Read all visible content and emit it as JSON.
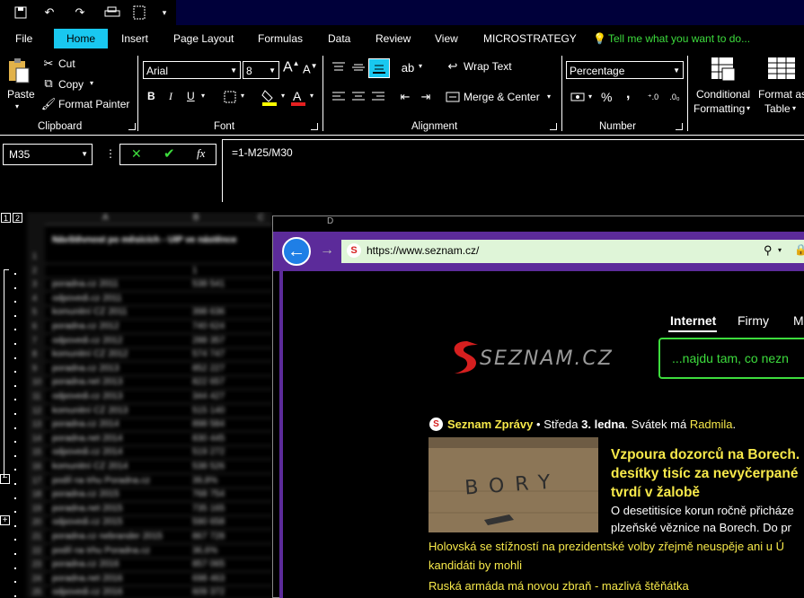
{
  "qat": {
    "icons": [
      "save-icon",
      "undo-icon",
      "redo-icon",
      "car-icon",
      "calculator-icon",
      "customize-icon"
    ]
  },
  "tabs": [
    "File",
    "Home",
    "Insert",
    "Page Layout",
    "Formulas",
    "Data",
    "Review",
    "View",
    "MICROSTRATEGY"
  ],
  "tell_me": "Tell me what you want to do...",
  "ribbon": {
    "clipboard": {
      "paste": "Paste",
      "cut": "Cut",
      "copy": "Copy",
      "format_painter": "Format Painter",
      "label": "Clipboard"
    },
    "font": {
      "name": "Arial",
      "size": "8",
      "bold": "B",
      "italic": "I",
      "underline": "U",
      "label": "Font"
    },
    "alignment": {
      "wrap_text": "Wrap Text",
      "merge_center": "Merge & Center",
      "label": "Alignment"
    },
    "number": {
      "format": "Percentage",
      "percent": "%",
      "comma": ",",
      "label": "Number"
    },
    "styles": {
      "conditional_1": "Conditional",
      "conditional_2": "Formatting",
      "format_as_1": "Format as",
      "format_as_2": "Table"
    }
  },
  "formula_bar": {
    "name_box": "M35",
    "formula": "=1-M25/M30"
  },
  "sheet": {
    "outline_levels": [
      "1",
      "2"
    ],
    "columns": [
      "A",
      "B",
      "C"
    ],
    "title": "Návštěvnost po měsících - UIP ve nástěnce",
    "rows": [
      {
        "n": "1",
        "label": "",
        "v": ""
      },
      {
        "n": "2",
        "label": "",
        "v": "1"
      },
      {
        "n": "3",
        "label": "poradna.cz 2011",
        "v": "538 541"
      },
      {
        "n": "4",
        "label": "odpovedi.cz 2011",
        "v": ""
      },
      {
        "n": "5",
        "label": "komunitní CZ 2011",
        "v": "398 636"
      },
      {
        "n": "6",
        "label": "poradna.cz 2012",
        "v": "740 624"
      },
      {
        "n": "7",
        "label": "odpovedi.cz 2012",
        "v": "288 357"
      },
      {
        "n": "8",
        "label": "komunitní CZ 2012",
        "v": "574 747"
      },
      {
        "n": "9",
        "label": "poradna.cz 2013",
        "v": "852 227"
      },
      {
        "n": "10",
        "label": "poradna.net 2013",
        "v": "822 657"
      },
      {
        "n": "11",
        "label": "odpovedi.cz 2013",
        "v": "344 427"
      },
      {
        "n": "12",
        "label": "komunitní CZ 2013",
        "v": "515 140"
      },
      {
        "n": "13",
        "label": "poradna.cz 2014",
        "v": "898 584"
      },
      {
        "n": "14",
        "label": "poradna.net 2014",
        "v": "830 445"
      },
      {
        "n": "15",
        "label": "odpovedi.cz 2014",
        "v": "519 272"
      },
      {
        "n": "16",
        "label": "komunitní CZ 2014",
        "v": "538 526"
      },
      {
        "n": "17",
        "label": "podíl na trhu Poradna.cz",
        "v": "39,8%"
      },
      {
        "n": "18",
        "label": "poradna.cz 2015",
        "v": "768 754"
      },
      {
        "n": "19",
        "label": "poradna.net 2015",
        "v": "735 165"
      },
      {
        "n": "20",
        "label": "odpovedi.cz 2015",
        "v": "590 658"
      },
      {
        "n": "21",
        "label": "poradna.cz nebrander 2015",
        "v": "867 728"
      },
      {
        "n": "22",
        "label": "podíl na trhu Poradna.cz",
        "v": "36,6%"
      },
      {
        "n": "23",
        "label": "poradna.cz 2016",
        "v": "857 065"
      },
      {
        "n": "24",
        "label": "poradna.net 2016",
        "v": "698 463"
      },
      {
        "n": "25",
        "label": "odpovedi.cz 2016",
        "v": "609 372"
      },
      {
        "n": "26",
        "label": "poradna.cz nebrander 2016",
        "v": "1 088 570"
      }
    ]
  },
  "browser": {
    "url": "https://www.seznam.cz/",
    "nav_tabs": [
      "Internet",
      "Firmy",
      "M"
    ],
    "search_placeholder": "...najdu tam, co nezn",
    "logo_text": "SEZNAM.CZ",
    "news_source": "Seznam Zprávy",
    "date_sep": "•",
    "date_prefix": "Středa",
    "date_bold": "3. ledna",
    "nameday_prefix": ". Svátek má",
    "nameday_name": "Radmila",
    "nameday_suffix": ".",
    "image_sign": "BORY",
    "headline": "Vzpoura dozorců na Borech. desítky tisíc za nevyčerpané tvrdí v žalobě",
    "perex": "O desetitisíce korun ročně přicháze plzeňské věznice na Borech. Do pr",
    "links": [
      "Holovská se stížností na prezidentské volby zřejmě neuspěje ani u Ú",
      "kandidáti by mohli",
      "Ruská armáda má novou zbraň - mazlivá štěňátka"
    ]
  },
  "colors": {
    "active_tab": "#19c8f0",
    "accent_green": "#3ddc3d",
    "news_yellow": "#f7e94a",
    "chrome_purple": "#5c2b9a"
  }
}
